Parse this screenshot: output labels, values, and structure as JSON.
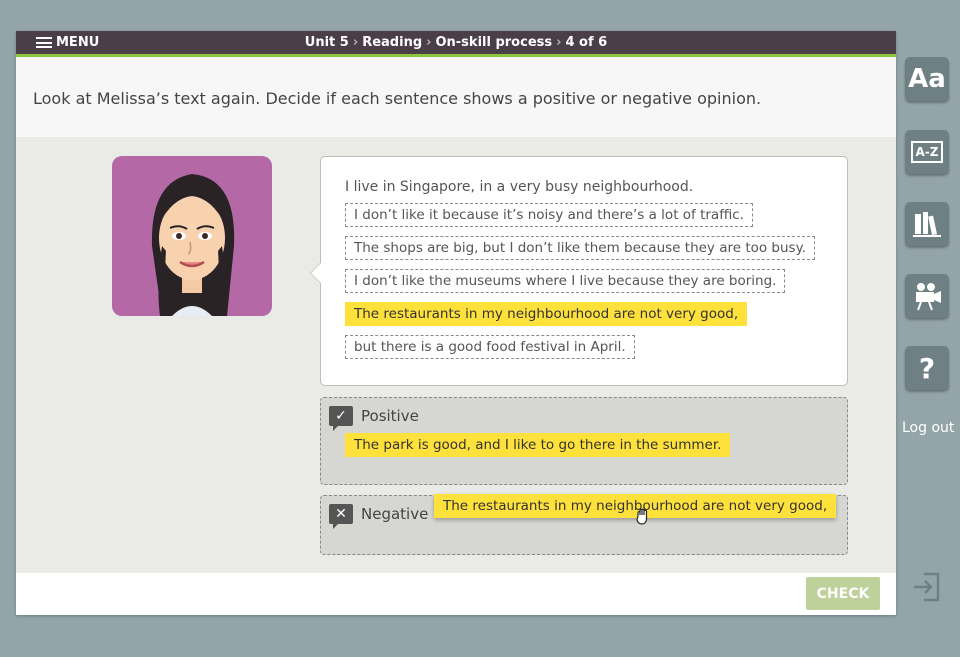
{
  "topbar": {
    "menu_label": "MENU",
    "breadcrumb": [
      "Unit 5",
      "Reading",
      "On-skill process",
      "4 of 6"
    ]
  },
  "instruction": "Look at Melissa’s text again. Decide if each sentence shows a positive or negative opinion.",
  "bubble": {
    "intro": "I live in Singapore, in a very busy neighbourhood.",
    "sentences": [
      "I don’t like it because it’s noisy and there’s a lot of traffic.",
      "The shops are big, but I don’t like them because they are too busy.",
      "I don’t like the museums where I live because they are boring.",
      "The restaurants in my neighbourhood are not very good,",
      "but there is a good food festival in April."
    ]
  },
  "zones": {
    "positive": {
      "label": "Positive",
      "items": [
        "The park is good, and I like to go there in the summer."
      ]
    },
    "negative": {
      "label": "Negative",
      "dragging": "The restaurants in my neighbourhood are not very good,"
    }
  },
  "footer": {
    "check_label": "CHECK"
  },
  "sidebar": {
    "glossary_label": "Aa",
    "dictionary_label": "A-Z",
    "help_label": "?",
    "logout_label": "Log out"
  },
  "colors": {
    "highlight": "#ffe13b",
    "topbar": "#4a3f48",
    "accent": "#8cc63f",
    "avatar_bg": "#b469a6",
    "check": "#bfd19b"
  },
  "icons": [
    "menu-icon",
    "chevron-right-icon",
    "check-icon",
    "cross-icon",
    "glossary-icon",
    "dictionary-icon",
    "books-icon",
    "video-camera-icon",
    "help-icon",
    "exit-icon",
    "grab-hand-cursor-icon"
  ]
}
